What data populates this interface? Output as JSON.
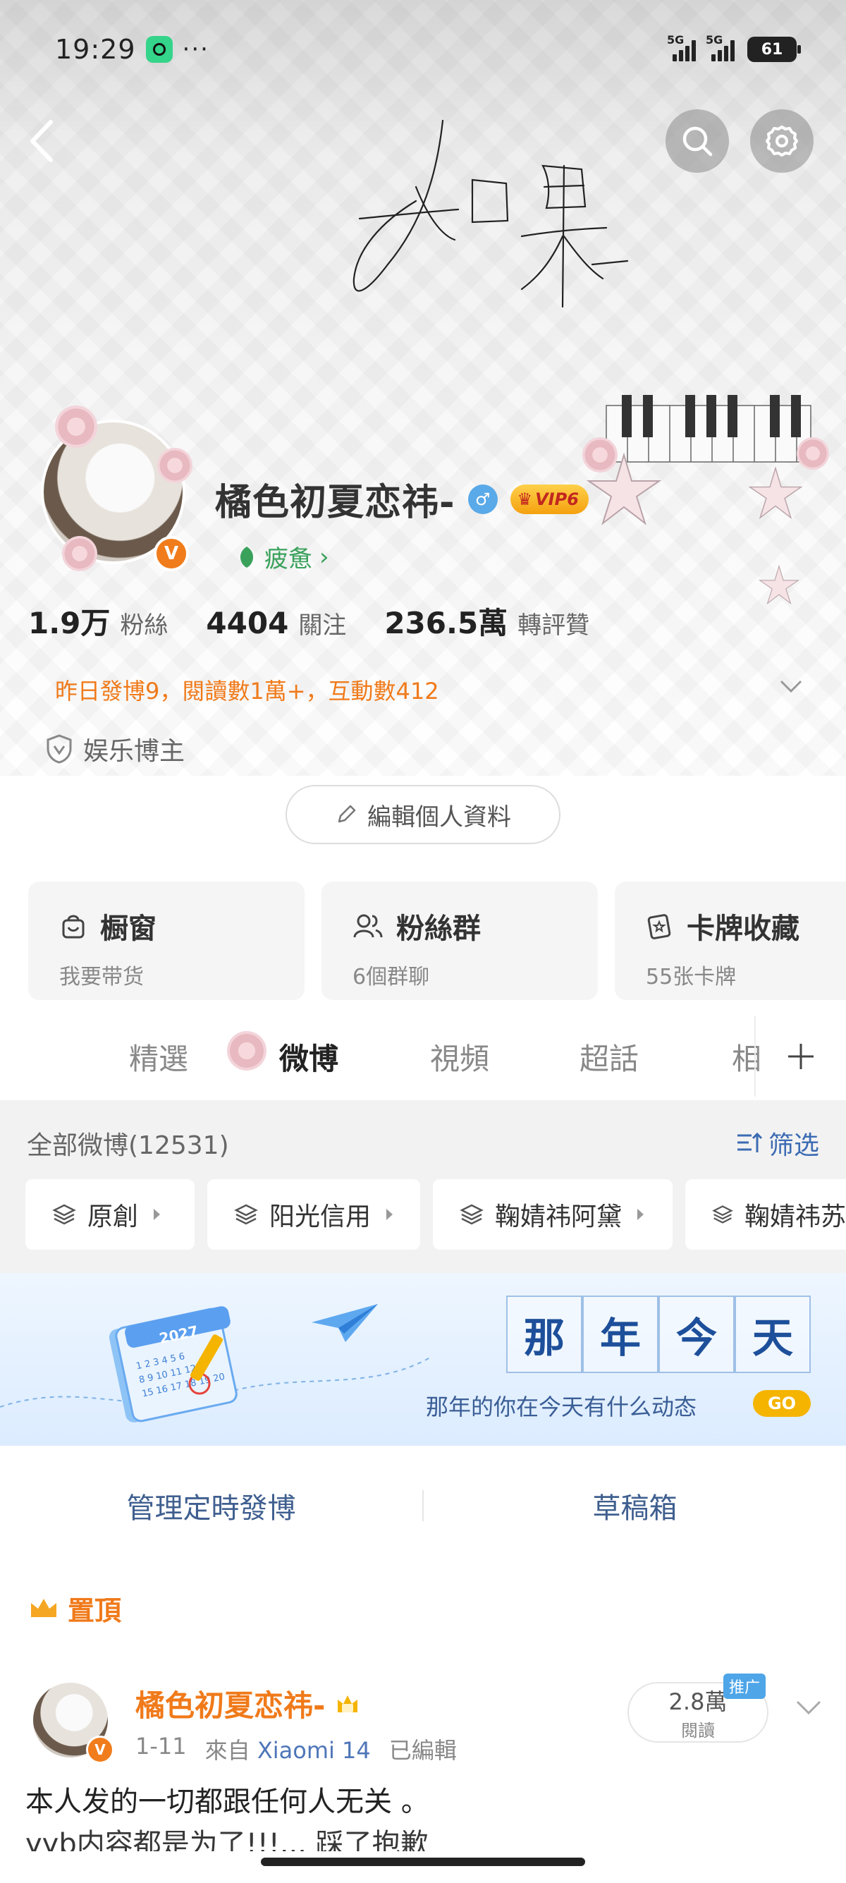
{
  "status_bar": {
    "time": "19:29",
    "signal1": "5G",
    "signal2": "5G",
    "battery": "61"
  },
  "header": {
    "signature_icon": "handwritten-signature"
  },
  "profile": {
    "name": "橘色初夏恋祎-",
    "gender_icon": "male-icon",
    "vip_label": "VIP6",
    "verify_badge": "V",
    "mood": "疲惫",
    "stats": [
      {
        "num": "1.9万",
        "label": "粉絲"
      },
      {
        "num": "4404",
        "label": "關注"
      },
      {
        "num": "236.5萬",
        "label": "轉評贊"
      }
    ],
    "yesterday": "昨日發博9，閱讀數1萬+，互動數412",
    "tagline": "娱乐博主",
    "edit_button": "編輯個人資料"
  },
  "cards": [
    {
      "title": "橱窗",
      "sub": "我要带货",
      "icon": "bag-icon"
    },
    {
      "title": "粉絲群",
      "sub": "6個群聊",
      "icon": "group-icon"
    },
    {
      "title": "卡牌收藏",
      "sub": "55张卡牌",
      "icon": "card-icon"
    }
  ],
  "tabs": [
    "精選",
    "微博",
    "視頻",
    "超話",
    "相"
  ],
  "filter": {
    "all": "全部微博(12531)",
    "sift": "筛选",
    "chips": [
      "原創",
      "阳光信用",
      "鞠婧祎阿黛",
      "鞠婧祎苏"
    ]
  },
  "banner": {
    "title_chars": [
      "那",
      "年",
      "今",
      "天"
    ],
    "subtitle": "那年的你在今天有什么动态",
    "go": "GO",
    "calendar_year": "2027"
  },
  "actions": {
    "scheduled": "管理定時發博",
    "drafts": "草稿箱"
  },
  "post": {
    "pinned": "置頂",
    "author": "橘色初夏恋祎-",
    "date": "1-11",
    "source_prefix": "來自",
    "device": "Xiaomi 14",
    "edited": "已編輯",
    "reads_num": "2.8萬",
    "reads_label": "閱讀",
    "promo": "推广",
    "text_line1": "本人发的一切都跟任何人无关 。",
    "text_line2": "yyb内容都是为了!!!... 踩了抱歉"
  },
  "colors": {
    "accent_orange": "#f07a1a",
    "link_blue": "#3c6bb3",
    "mood_green": "#3aa15b"
  }
}
